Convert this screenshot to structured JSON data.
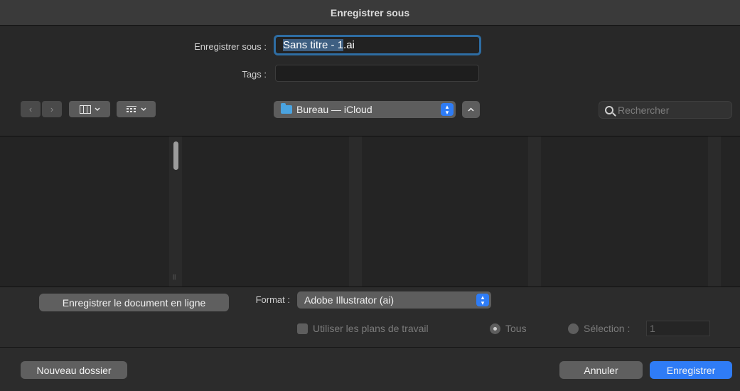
{
  "window": {
    "title": "Enregistrer sous"
  },
  "form": {
    "save_as_label": "Enregistrer sous :",
    "filename_selected": "Sans titre - 1",
    "filename_ext": ".ai",
    "tags_label": "Tags :",
    "tags_value": ""
  },
  "toolbar": {
    "back_glyph": "‹",
    "forward_glyph": "›",
    "location": "Bureau — iCloud",
    "search_placeholder": "Rechercher"
  },
  "bottom": {
    "save_online_button": "Enregistrer le document en ligne",
    "format_label": "Format :",
    "format_value": "Adobe Illustrator (ai)",
    "use_artboards_label": "Utiliser les plans de travail",
    "all_label": "Tous",
    "selection_label": "Sélection :",
    "selection_value": "1",
    "new_folder_button": "Nouveau dossier",
    "cancel_button": "Annuler",
    "save_button": "Enregistrer"
  },
  "colors": {
    "accent": "#2f7cf6",
    "focus_ring": "#2e6da3",
    "folder": "#4aa3e0"
  },
  "icons": [
    "back-chevron-icon",
    "forward-chevron-icon",
    "column-view-icon",
    "chevron-down-icon",
    "group-icon",
    "folder-icon",
    "stepper-icon",
    "chevron-up-icon",
    "search-icon"
  ]
}
